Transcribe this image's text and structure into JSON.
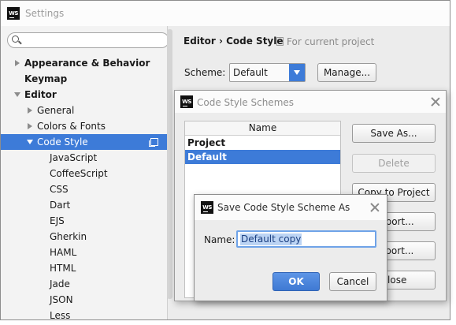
{
  "window": {
    "title": "Settings",
    "logo": "WS",
    "search_placeholder": ""
  },
  "sidebar": {
    "items": [
      {
        "label": "Appearance & Behavior",
        "bold": true,
        "arrow": "right"
      },
      {
        "label": "Keymap",
        "bold": true,
        "arrow": "none"
      },
      {
        "label": "Editor",
        "bold": true,
        "arrow": "down"
      },
      {
        "label": "General",
        "bold": false,
        "arrow": "right"
      },
      {
        "label": "Colors & Fonts",
        "bold": false,
        "arrow": "right"
      },
      {
        "label": "Code Style",
        "bold": false,
        "arrow": "down",
        "selected": true
      },
      {
        "label": "JavaScript"
      },
      {
        "label": "CoffeeScript"
      },
      {
        "label": "CSS"
      },
      {
        "label": "Dart"
      },
      {
        "label": "EJS"
      },
      {
        "label": "Gherkin"
      },
      {
        "label": "HAML"
      },
      {
        "label": "HTML"
      },
      {
        "label": "Jade"
      },
      {
        "label": "JSON"
      },
      {
        "label": "Less"
      }
    ]
  },
  "content": {
    "breadcrumb": "Editor › Code Style",
    "breadcrumb_note": "For current project",
    "scheme_label": "Scheme:",
    "scheme_value": "Default",
    "manage_label": "Manage..."
  },
  "schemes_dialog": {
    "title": "Code Style Schemes",
    "logo": "WS",
    "column_header": "Name",
    "rows": [
      {
        "label": "Project",
        "selected": false
      },
      {
        "label": "Default",
        "selected": true
      }
    ],
    "buttons": {
      "save_as": "Save As...",
      "delete": "Delete",
      "copy_to_project": "Copy to Project",
      "import": "Import...",
      "export": "Export...",
      "close": "Close"
    }
  },
  "save_dialog": {
    "title": "Save Code Style Scheme As",
    "logo": "WS",
    "name_label": "Name:",
    "name_value": "Default copy",
    "ok_label": "OK",
    "cancel_label": "Cancel"
  },
  "colors": {
    "accent": "#3d7bd8",
    "selection": "#bcd4f4"
  },
  "icons": {
    "search": "search-icon",
    "close": "close-icon",
    "copy": "copy-icon",
    "dropdown": "chevron-down-icon"
  }
}
